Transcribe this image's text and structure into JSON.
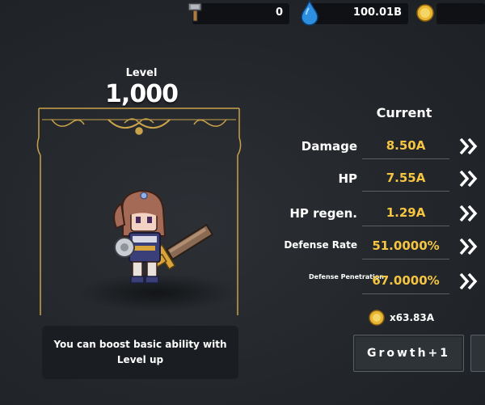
{
  "resources": {
    "key": {
      "value": "0",
      "icon": "hammer-key-icon"
    },
    "gem": {
      "value": "100.01B",
      "icon": "blue-gem-icon"
    },
    "gold": {
      "value": "",
      "icon": "gold-coin-icon"
    }
  },
  "level": {
    "label": "Level",
    "value": "1,000"
  },
  "tip": "You can boost basic ability with Level up",
  "stats_title": "Current",
  "stats": [
    {
      "label": "Damage",
      "value": "8.50A"
    },
    {
      "label": "HP",
      "value": "7.55A"
    },
    {
      "label": "HP regen.",
      "value": "1.29A"
    },
    {
      "label": "Defense Rate",
      "value": "51.0000%"
    },
    {
      "label": "Defense Penetration",
      "value": "67.0000%"
    }
  ],
  "cost": "x63.83A",
  "growth_button": "Growth+1",
  "colors": {
    "value_gold": "#f5c542",
    "frame_gold": "#c9a24a",
    "panel": "#1a1d21"
  }
}
